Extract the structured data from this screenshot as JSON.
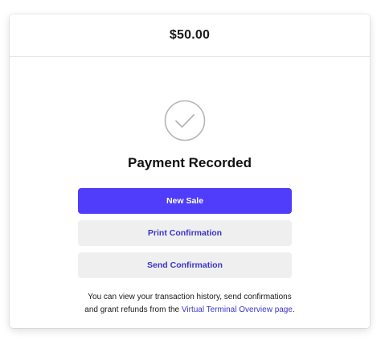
{
  "header": {
    "amount": "$50.00"
  },
  "status": {
    "icon": "checkmark-circle-icon",
    "title": "Payment Recorded"
  },
  "actions": {
    "new_sale_label": "New Sale",
    "print_label": "Print Confirmation",
    "send_label": "Send Confirmation"
  },
  "footnote": {
    "line1": "You can view your transaction history, send confirmations",
    "line2_prefix": "and grant refunds from the",
    "link_label": "Virtual Terminal Overview page",
    "line2_suffix": "."
  },
  "colors": {
    "primary_button": "#4f3dfb",
    "secondary_button": "#efefef",
    "link": "#3a35c8",
    "check_stroke": "#b5b5b5"
  }
}
